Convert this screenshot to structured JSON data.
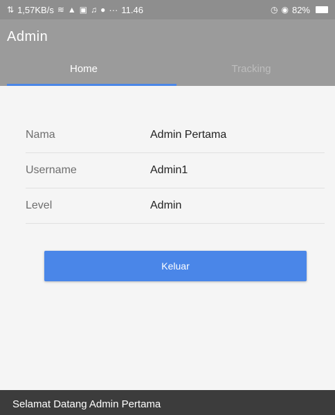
{
  "status_bar": {
    "network_speed": "1,57KB/s",
    "time": "11.46",
    "battery": "82%",
    "dots": "···"
  },
  "app_bar": {
    "title": "Admin",
    "tabs": [
      {
        "label": "Home",
        "active": true
      },
      {
        "label": "Tracking",
        "active": false
      }
    ],
    "accent_color": "#4a86e8"
  },
  "profile": {
    "rows": [
      {
        "label": "Nama",
        "value": "Admin Pertama"
      },
      {
        "label": "Username",
        "value": "Admin1"
      },
      {
        "label": "Level",
        "value": "Admin"
      }
    ]
  },
  "actions": {
    "logout_label": "Keluar"
  },
  "footer": {
    "welcome_text": "Selamat Datang Admin Pertama"
  }
}
